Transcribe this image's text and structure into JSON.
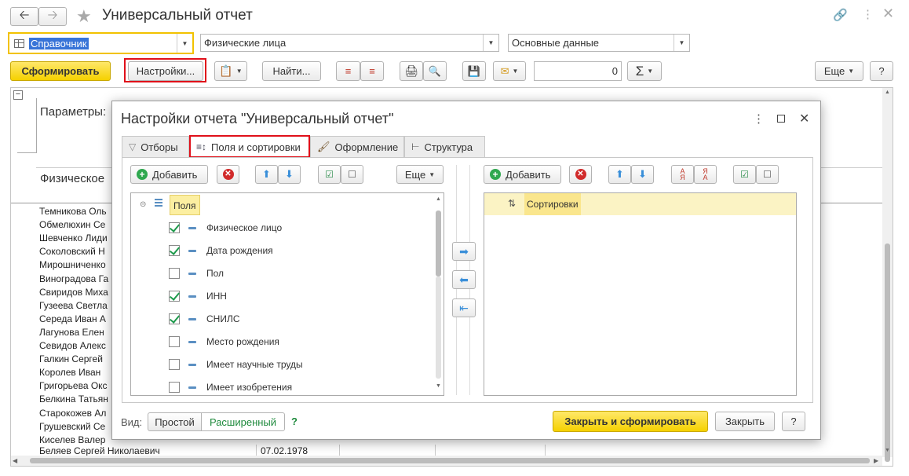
{
  "window": {
    "title": "Универсальный отчет"
  },
  "toolbar1": {
    "report_kind": "Справочник",
    "object": "Физические лица",
    "variant": "Основные данные"
  },
  "toolbar2": {
    "generate": "Сформировать",
    "settings": "Настройки...",
    "find": "Найти...",
    "sum_value": "0",
    "more": "Еще",
    "help": "?"
  },
  "report": {
    "params_label": "Параметры:",
    "column_header": "Физическое",
    "rows": [
      "Темникова Оль",
      "Обмелюхин Се",
      "Шевченко Лиди",
      "Соколовский Н",
      "Мирошниченко",
      "Виноградова Га",
      "Свиридов Миха",
      "Гузеева Светла",
      "Середа Иван А",
      "Лагунова Елен",
      "Севидов Алекс",
      "Галкин Сергей",
      "Королев Иван",
      "Григорьева Окс",
      "Белкина Татьян",
      "Старокожев Ал",
      "Грушевский Се",
      "Киселев Валер"
    ],
    "last_row_name": "Беляев Сергей Николаевич",
    "last_row_date": "07.02.1978"
  },
  "dialog": {
    "title": "Настройки отчета \"Универсальный отчет\"",
    "tabs": [
      "Отборы",
      "Поля и сортировки",
      "Оформление",
      "Структура"
    ],
    "left": {
      "add": "Добавить",
      "more": "Еще",
      "root": "Поля",
      "fields": [
        {
          "label": "Физическое лицо",
          "checked": true
        },
        {
          "label": "Дата рождения",
          "checked": true
        },
        {
          "label": "Пол",
          "checked": false
        },
        {
          "label": "ИНН",
          "checked": true
        },
        {
          "label": "СНИЛС",
          "checked": true
        },
        {
          "label": "Место рождения",
          "checked": false
        },
        {
          "label": "Имеет научные труды",
          "checked": false
        },
        {
          "label": "Имеет изобретения",
          "checked": false
        }
      ]
    },
    "right": {
      "add": "Добавить",
      "root": "Сортировки"
    },
    "footer": {
      "view_label": "Вид:",
      "simple": "Простой",
      "extended": "Расширенный",
      "hint": "?",
      "close_generate": "Закрыть и сформировать",
      "close": "Закрыть",
      "help": "?"
    }
  },
  "colors": {
    "accent_yellow": "#f5d100",
    "highlight_red": "#e0101a",
    "link_green": "#1e8a3c"
  }
}
